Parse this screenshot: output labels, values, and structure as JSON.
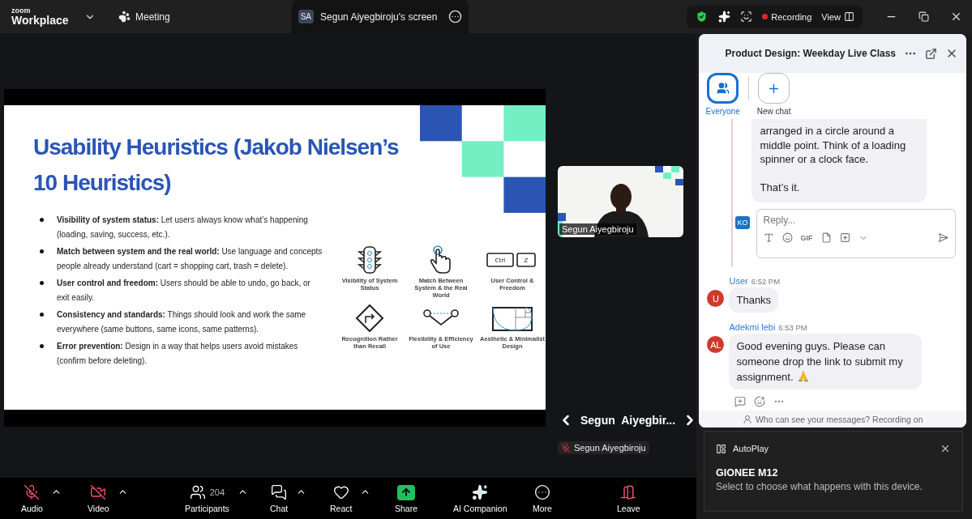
{
  "app_bar": {
    "logo_top": "zoom",
    "logo_bottom": "Workplace",
    "meeting": "Meeting",
    "screen_tab": {
      "initials": "SA",
      "label": "Segun Aiyegbiroju's screen",
      "selected": true
    },
    "recording": "Recording",
    "view": "View"
  },
  "slide": {
    "title_lines": [
      "Usability Heuristics (Jakob Nielsen’s",
      "10 Heuristics)"
    ],
    "bullets": [
      "**Visibility of system status:** Let users always know what’s happening (loading, saving, success, etc.).",
      "**Match between system and the real world:** Use language and concepts people already understand (cart = shopping cart, trash = delete).",
      "**User control and freedom:** Users should be able to undo, go back, or exit easily.",
      "**Consistency and standards:** Things should look and work the same everywhere (same buttons, same icons, same patterns).",
      "**Error prevention:** Design in a way that helps users avoid mistakes (confirm before deleting)."
    ],
    "heuristics": [
      {
        "kind": "traffic-light",
        "label": "Visibility of System Status"
      },
      {
        "kind": "hand",
        "label": "Match Between System & the Real World"
      },
      {
        "kind": "keys",
        "label": "User Control & Freedom",
        "keys": [
          "Ctrl",
          "Z"
        ]
      },
      {
        "kind": "turn",
        "label": "Recognition Rather than Recall"
      },
      {
        "kind": "flex",
        "label": "Flexibility & Efficiency of Use"
      },
      {
        "kind": "golden",
        "label": "Aesthetic & Minimalist Design"
      }
    ]
  },
  "video_tile": {
    "kind": "picture",
    "name": "Segun Aiyegbiroju"
  },
  "speaker_nav": {
    "name": "Segun Aiyegbir..."
  },
  "name_tag": {
    "name": "Segun Aiyegbiroju",
    "muted": true
  },
  "toolbar": [
    {
      "kind": "audio",
      "label": "Audio",
      "muted": true,
      "caret": true
    },
    {
      "kind": "video",
      "label": "Video",
      "muted": true,
      "caret": true
    },
    {
      "kind": "participants",
      "label": "Participants",
      "count": "204",
      "caret": true
    },
    {
      "kind": "chat",
      "label": "Chat",
      "caret": true
    },
    {
      "kind": "react",
      "label": "React",
      "caret": true
    },
    {
      "kind": "share",
      "label": "Share",
      "caret": false
    },
    {
      "kind": "ai",
      "label": "AI Companion",
      "caret": false
    },
    {
      "kind": "more",
      "label": "More",
      "caret": false
    },
    {
      "kind": "leave",
      "label": "Leave",
      "caret": false
    }
  ],
  "chat": {
    "title": "Product Design: Weekday Live Class",
    "channels": [
      {
        "kind": "everyone",
        "label": "Everyone",
        "selected": true
      },
      {
        "kind": "new",
        "label": "New chat",
        "selected": false
      }
    ],
    "thread": {
      "text": "arranged in a circle around a middle point. Think of a loading spinner or a clock face.",
      "closing": "That’s it.",
      "reply_avatar": "KO",
      "reply_placeholder": "Reply...",
      "gif": "GIF"
    },
    "messages": [
      {
        "sender": "User",
        "time": "6:52 PM",
        "avatar": "U",
        "text": "Thanks",
        "emoji": false
      },
      {
        "sender": "Adekmi lebi",
        "time": "6:53 PM",
        "avatar": "AL",
        "text": "Good evening guys. Please can someone drop the link to submit my assignment.",
        "emoji": true
      }
    ],
    "footer": "Who can see your messages? Recording on"
  },
  "autoplay": {
    "source": "AutoPlay",
    "title": "GIONEE M12",
    "text": "Select to choose what happens with this device."
  }
}
